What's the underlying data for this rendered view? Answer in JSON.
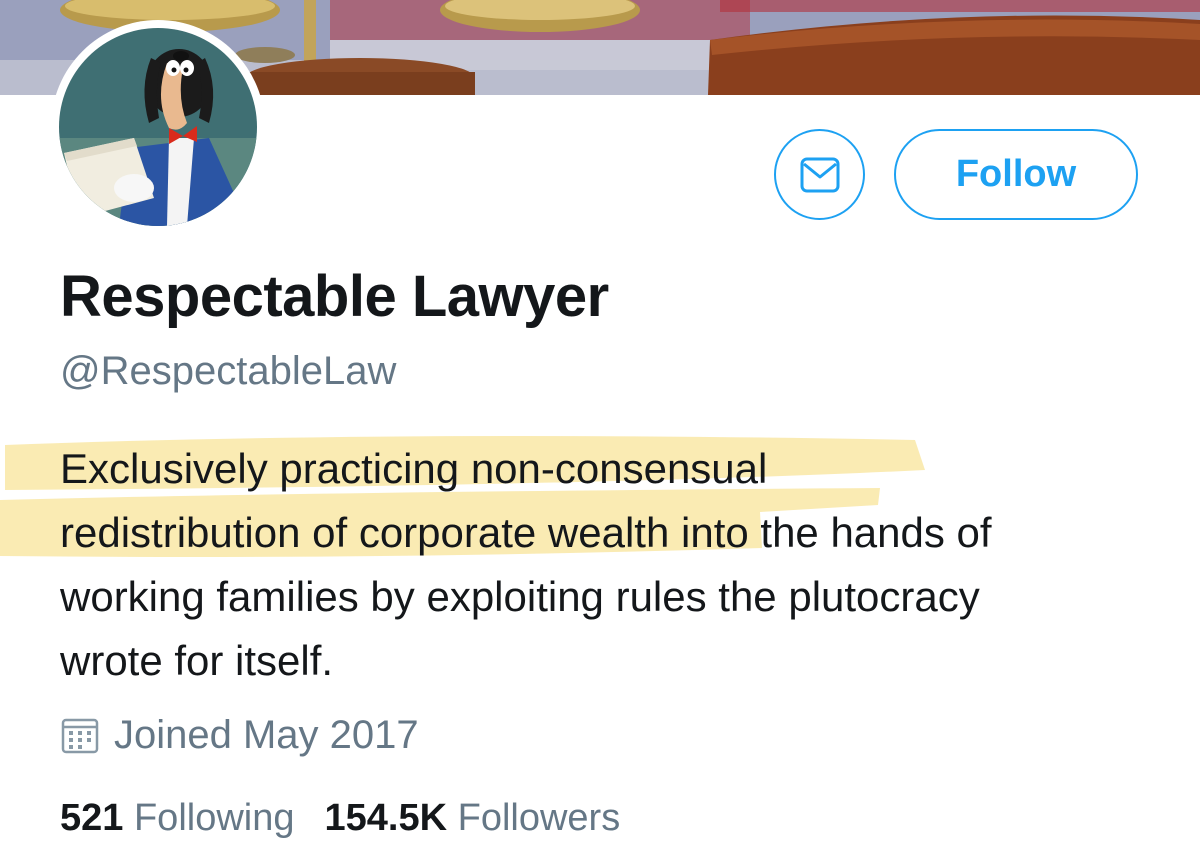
{
  "profile": {
    "display_name": "Respectable Lawyer",
    "handle": "@RespectableLaw",
    "bio_lines": [
      {
        "highlighted": "Exclusively practicing non-consensual",
        "rest": ""
      },
      {
        "highlighted": "redistribution of corporate wealt",
        "rest": "h into the hands of"
      },
      {
        "highlighted": "",
        "rest": "working families by exploiting rules the plutocracy"
      },
      {
        "highlighted": "",
        "rest": "wrote for itself."
      }
    ],
    "joined": "Joined May 2017",
    "stats": {
      "following_count": "521",
      "following_label": "Following",
      "followers_count": "154.5K",
      "followers_label": "Followers"
    }
  },
  "actions": {
    "message_icon": "envelope-icon",
    "follow_label": "Follow"
  },
  "icons": {
    "joined": "calendar-icon",
    "avatar": "cartoon-dog-in-suit"
  },
  "colors": {
    "accent": "#1da1f2",
    "secondary_text": "#657786",
    "primary_text": "#14171a",
    "highlighter": "#f7e08a"
  }
}
